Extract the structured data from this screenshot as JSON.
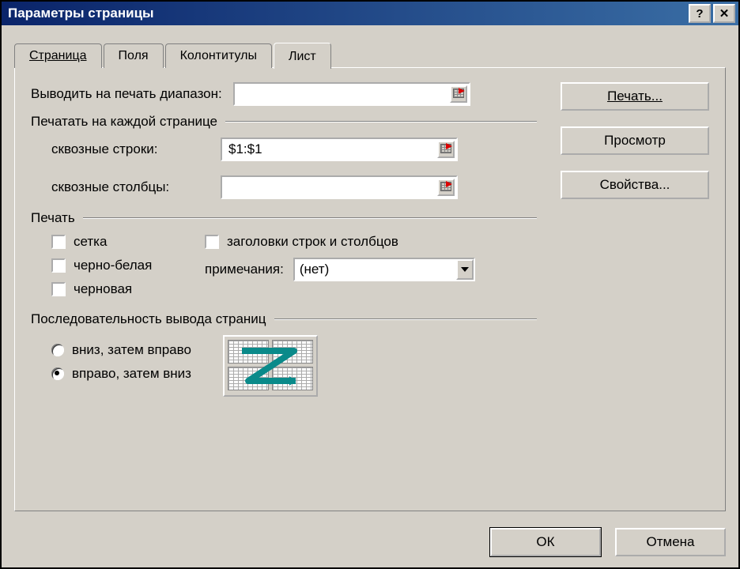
{
  "window": {
    "title": "Параметры страницы"
  },
  "tabs": {
    "page": "Страница",
    "fields": "Поля",
    "headers": "Колонтитулы",
    "sheet": "Лист"
  },
  "sheet": {
    "print_range_label": "Выводить на печать диапазон:",
    "print_range_value": "",
    "repeat_group": "Печатать на каждой странице",
    "rows_label": "сквозные строки:",
    "rows_value": "$1:$1",
    "cols_label": "сквозные столбцы:",
    "cols_value": "",
    "print_group": "Печать",
    "grid": "сетка",
    "bw": "черно-белая",
    "draft": "черновая",
    "headings": "заголовки строк и столбцов",
    "notes_label": "примечания:",
    "notes_value": "(нет)",
    "order_group": "Последовательность вывода страниц",
    "down_then_over": "вниз, затем вправо",
    "over_then_down": "вправо, затем вниз"
  },
  "buttons": {
    "print": "Печать...",
    "preview": "Просмотр",
    "options": "Свойства...",
    "ok": "ОК",
    "cancel": "Отмена"
  }
}
